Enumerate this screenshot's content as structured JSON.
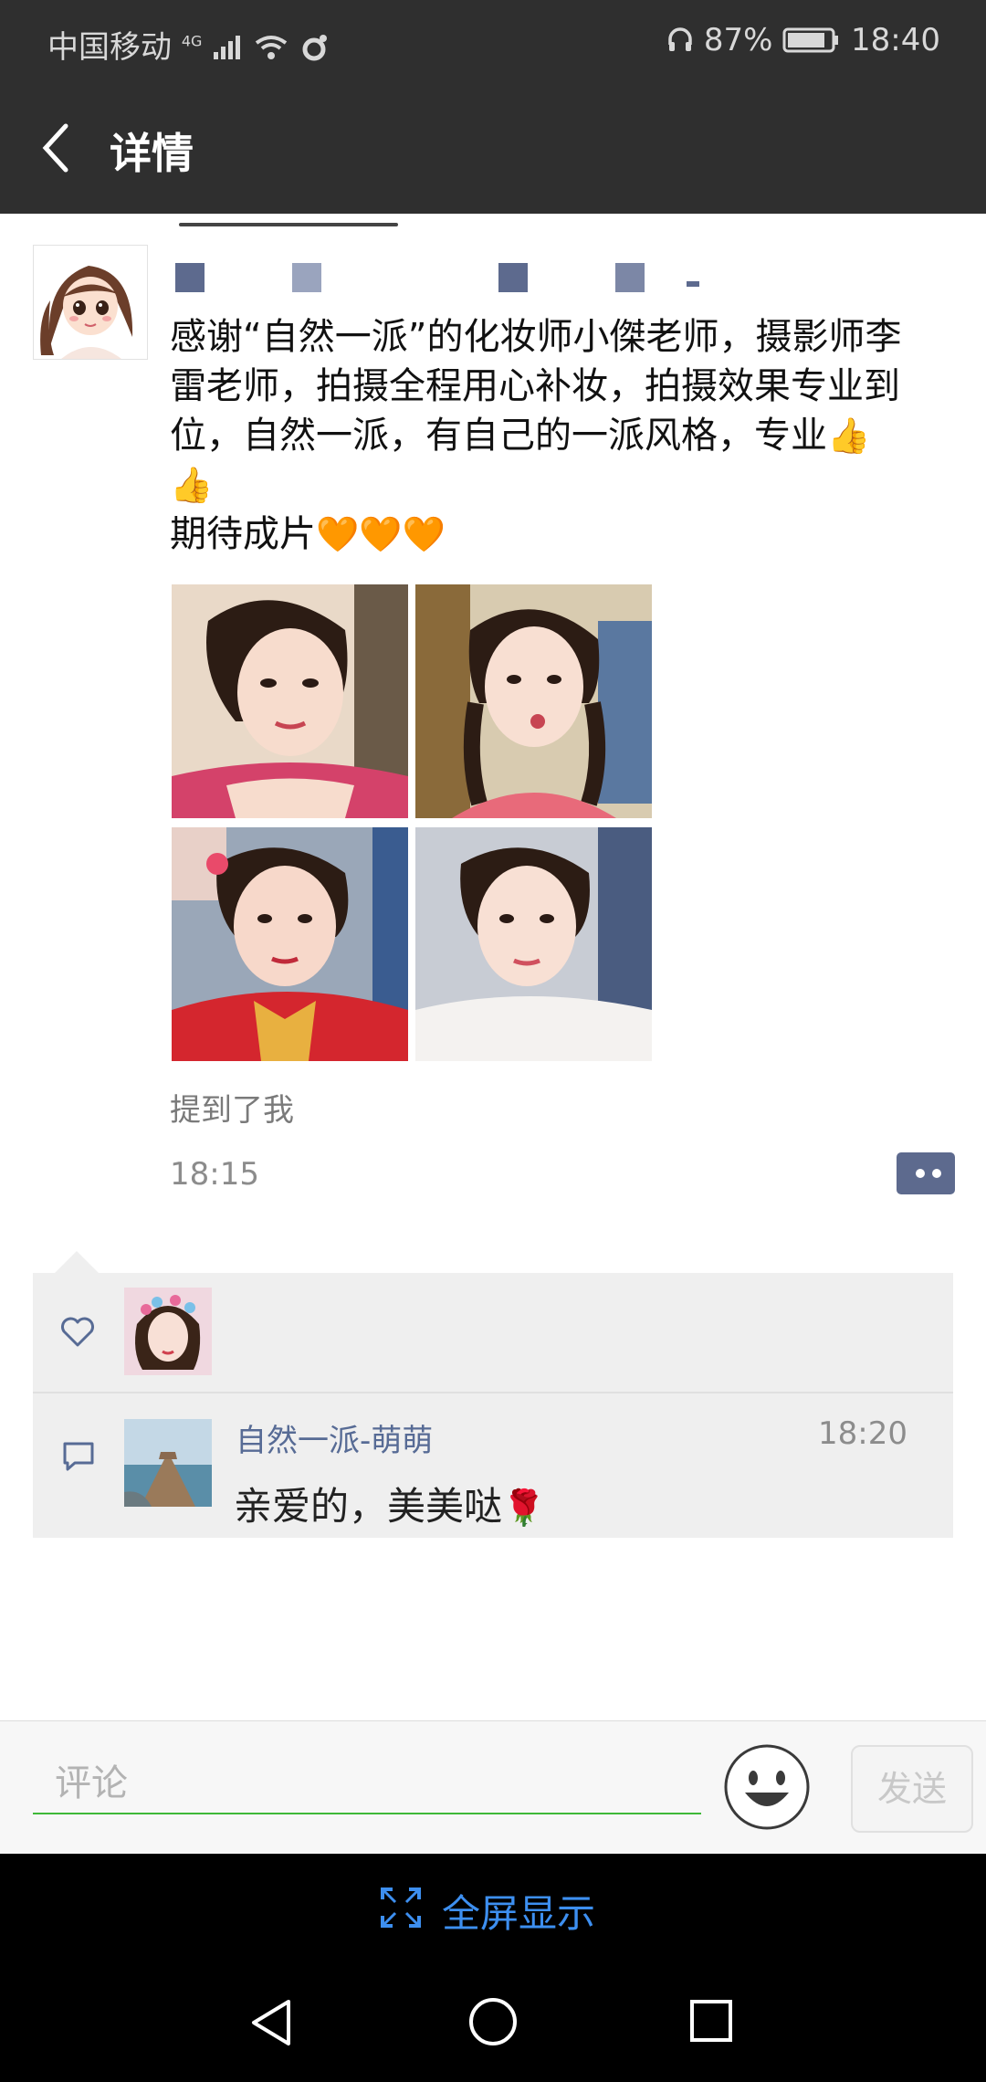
{
  "status_bar": {
    "carrier": "中国移动",
    "network": "4G",
    "battery": "87%",
    "time": "18:40"
  },
  "header": {
    "title": "详情"
  },
  "post": {
    "text_lines": [
      "感谢“自然一派”的化妆师小傑老师，摄影师李",
      "雷老师，拍摄全程用心补妆，拍摄效果专业到",
      "位，自然一派，有自己的一派风格，专业",
      "期待成片"
    ],
    "emojis": {
      "thumbs": "👍",
      "heart": "🧡"
    },
    "photos": [
      "portrait-pink-top",
      "portrait-braids",
      "portrait-red-qipao",
      "portrait-white-dress"
    ],
    "mention": "提到了我",
    "time": "18:15"
  },
  "interactions": {
    "comment": {
      "author": "自然一派-萌萌",
      "time": "18:20",
      "text": "亲爱的，美美哒",
      "emoji": "🌹"
    }
  },
  "input": {
    "placeholder": "评论",
    "send_label": "发送"
  },
  "fullscreen": {
    "label": "全屏显示"
  },
  "colors": {
    "header_bg": "#2f2f2f",
    "link_blue": "#576b95",
    "accent_green": "#3fb838",
    "fullscreen_blue": "#3d8ff0"
  }
}
